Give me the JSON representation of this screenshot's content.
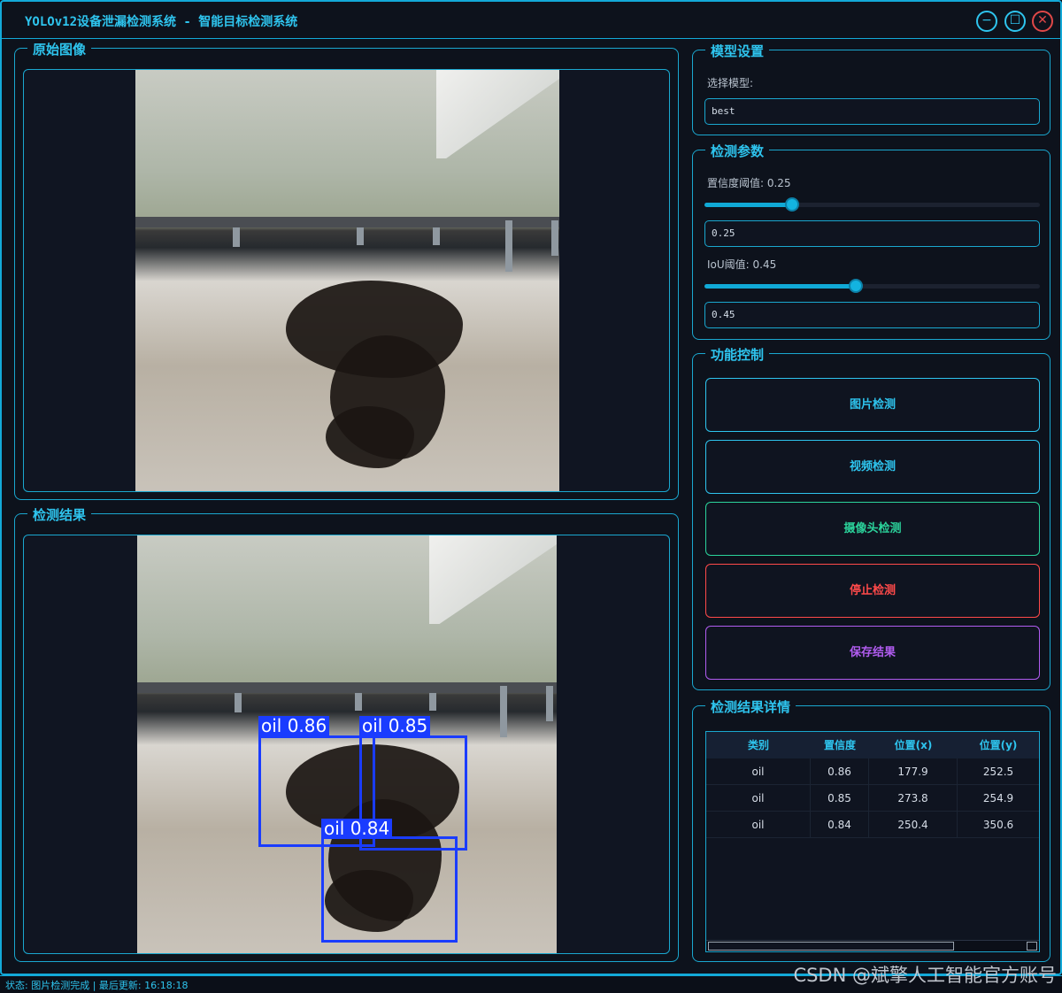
{
  "window": {
    "title": "YOLOv12设备泄漏检测系统 - 智能目标检测系统",
    "minimize_icon": "minimize-icon",
    "maximize_icon": "maximize-icon",
    "close_icon": "close-icon",
    "minimize_glyph": "−",
    "maximize_glyph": "☐",
    "close_glyph": "✕"
  },
  "original_panel": {
    "title": "原始图像"
  },
  "result_panel": {
    "title": "检测结果",
    "detections": [
      {
        "label": "oil 0.86"
      },
      {
        "label": "oil 0.85"
      },
      {
        "label": "oil 0.84"
      }
    ]
  },
  "model_settings": {
    "title": "模型设置",
    "select_label": "选择模型:",
    "selected_model": "best"
  },
  "detect_params": {
    "title": "检测参数",
    "confidence_label": "置信度阈值: 0.25",
    "confidence_value": "0.25",
    "confidence_level": 0.25,
    "iou_label": "IoU阈值: 0.45",
    "iou_value": "0.45",
    "iou_level": 0.45
  },
  "controls": {
    "title": "功能控制",
    "image_detect": "图片检测",
    "video_detect": "视频检测",
    "camera_detect": "摄像头检测",
    "stop_detect": "停止检测",
    "save_result": "保存结果",
    "colors": {
      "image_detect": "#2ec4ee",
      "video_detect": "#2ec4ee",
      "camera_detect": "#2bd39b",
      "stop_detect": "#ff4a4a",
      "save_result": "#b15cf0"
    }
  },
  "results_detail": {
    "title": "检测结果详情",
    "columns": [
      "类别",
      "置信度",
      "位置(x)",
      "位置(y)"
    ],
    "rows": [
      [
        "oil",
        "0.86",
        "177.9",
        "252.5"
      ],
      [
        "oil",
        "0.85",
        "273.8",
        "254.9"
      ],
      [
        "oil",
        "0.84",
        "250.4",
        "350.6"
      ]
    ]
  },
  "status": {
    "text": "状态: 图片检测完成 | 最后更新: 16:18:18"
  },
  "watermark": "CSDN @斌擎人工智能官方账号"
}
